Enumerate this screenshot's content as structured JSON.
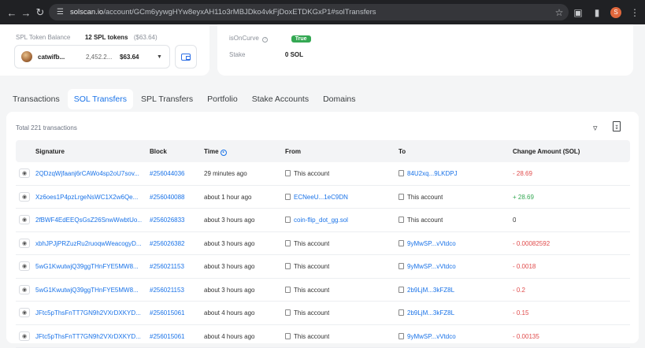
{
  "browser": {
    "url_domain": "solscan.io",
    "url_path": "/account/GCm6yywgHYw8eyxAH11o3rMBJDko4vkFjDoxETDKGxP1#solTransfers"
  },
  "account": {
    "spl_balance_label": "SPL Token Balance",
    "spl_balance_value": "12 SPL tokens",
    "spl_balance_usd": "($63.64)",
    "token_name": "catwifb...",
    "token_amount": "2,452.2...",
    "token_usd": "$63.64",
    "is_on_curve_label": "isOnCurve",
    "is_on_curve_value": "True",
    "stake_label": "Stake",
    "stake_value": "0 SOL"
  },
  "tabs": [
    "Transactions",
    "SOL Transfers",
    "SPL Transfers",
    "Portfolio",
    "Stake Accounts",
    "Domains"
  ],
  "table": {
    "total": "Total 221 transactions",
    "headers": {
      "signature": "Signature",
      "block": "Block",
      "time": "Time",
      "from": "From",
      "to": "To",
      "amount": "Change Amount (SOL)"
    },
    "rows": [
      {
        "sig": "2QDzqWjfaanj6rCAWo4sp2oU7sov...",
        "block": "#256044036",
        "time": "29 minutes ago",
        "from": "This account",
        "from_link": false,
        "to": "84U2xq...9LKDPJ",
        "to_link": true,
        "amount": "- 28.69",
        "sign": "neg"
      },
      {
        "sig": "Xz6oes1P4pzLrgeNsWC1X2w6Qe...",
        "block": "#256040088",
        "time": "about 1 hour ago",
        "from": "ECNeeU...1eC9DN",
        "from_link": true,
        "to": "This account",
        "to_link": false,
        "amount": "+ 28.69",
        "sign": "pos"
      },
      {
        "sig": "2fBWF4EdEEQsGsZ26SnwWwbtUo...",
        "block": "#256026833",
        "time": "about 3 hours ago",
        "from": "coin-flip_dot_gg.sol",
        "from_link": true,
        "to": "This account",
        "to_link": false,
        "amount": "0",
        "sign": "zero"
      },
      {
        "sig": "xbhJPJjPRZuzRu2ruoqwWeacogyD...",
        "block": "#256026382",
        "time": "about 3 hours ago",
        "from": "This account",
        "from_link": false,
        "to": "9yMwSP...vVtdco",
        "to_link": true,
        "amount": "- 0.00082592",
        "sign": "neg"
      },
      {
        "sig": "5wG1KwutwjQ39ggTHnFYE5MW8...",
        "block": "#256021153",
        "time": "about 3 hours ago",
        "from": "This account",
        "from_link": false,
        "to": "9yMwSP...vVtdco",
        "to_link": true,
        "amount": "- 0.0018",
        "sign": "neg"
      },
      {
        "sig": "5wG1KwutwjQ39ggTHnFYE5MW8...",
        "block": "#256021153",
        "time": "about 3 hours ago",
        "from": "This account",
        "from_link": false,
        "to": "2b9LjM...3kFZ8L",
        "to_link": true,
        "amount": "- 0.2",
        "sign": "neg"
      },
      {
        "sig": "JFtc5pThsFnTT7GN9h2VXrDXKYD...",
        "block": "#256015061",
        "time": "about 4 hours ago",
        "from": "This account",
        "from_link": false,
        "to": "2b9LjM...3kFZ8L",
        "to_link": true,
        "amount": "- 0.15",
        "sign": "neg"
      },
      {
        "sig": "JFtc5pThsFnTT7GN9h2VXrDXKYD...",
        "block": "#256015061",
        "time": "about 4 hours ago",
        "from": "This account",
        "from_link": false,
        "to": "9yMwSP...vVtdco",
        "to_link": true,
        "amount": "- 0.00135",
        "sign": "neg"
      }
    ]
  }
}
